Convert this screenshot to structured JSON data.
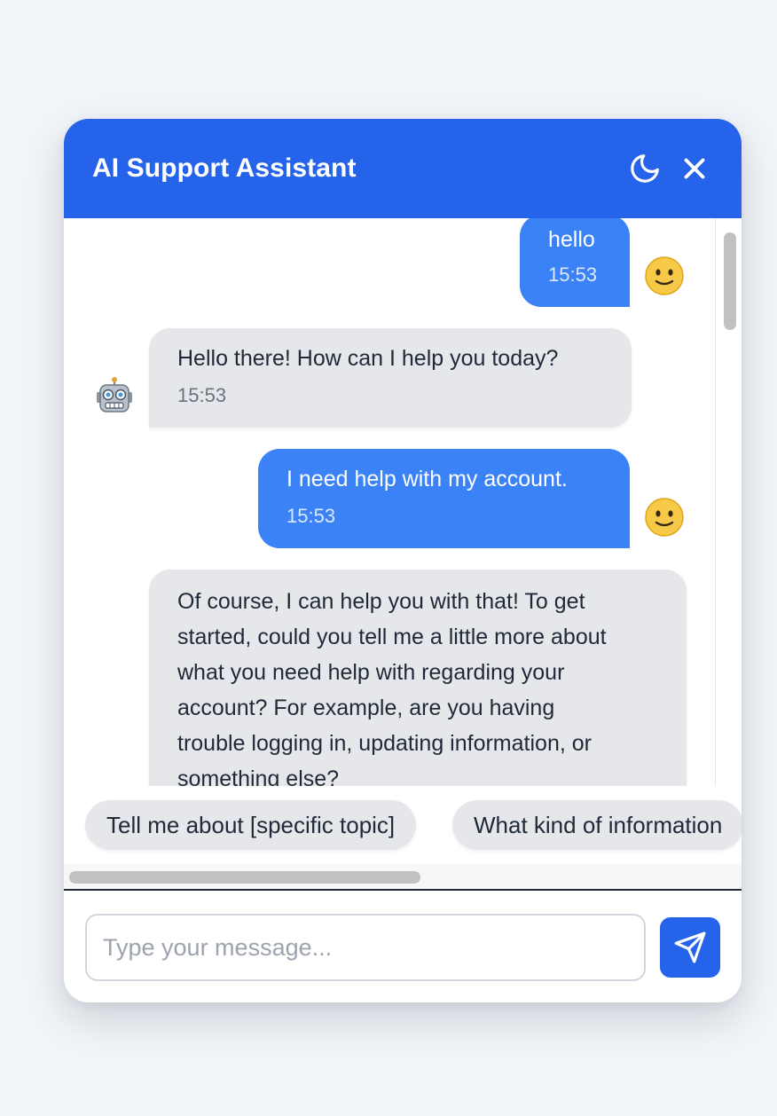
{
  "header": {
    "title": "AI Support Assistant",
    "theme_toggle_icon": "moon-icon",
    "close_icon": "close-icon"
  },
  "messages": [
    {
      "role": "user",
      "lines": [
        "hello"
      ],
      "time": "15:53",
      "avatar": "slightly-smiling-face-emoji"
    },
    {
      "role": "bot",
      "lines": [
        "Hello there! How can I help you today?"
      ],
      "time": "15:53",
      "avatar": "robot-emoji"
    },
    {
      "role": "user",
      "lines": [
        "I need help with my account."
      ],
      "time": "15:53",
      "avatar": "slightly-smiling-face-emoji"
    },
    {
      "role": "bot",
      "lines": [
        "Of course, I can help you with that! To get",
        "started, could you tell me a little more about",
        "what you need help with regarding your",
        "account? For example, are you having",
        "trouble logging in, updating information, or",
        "something else?"
      ]
    }
  ],
  "suggestions": [
    "Tell me about [specific topic]",
    "What kind of information"
  ],
  "composer": {
    "placeholder": "Type your message...",
    "send_icon": "send-icon"
  },
  "colors": {
    "primary": "#2563eb",
    "user_bubble": "#3b82f6",
    "bot_bubble": "#e5e7eb",
    "page_background": "#f1f4f8"
  }
}
